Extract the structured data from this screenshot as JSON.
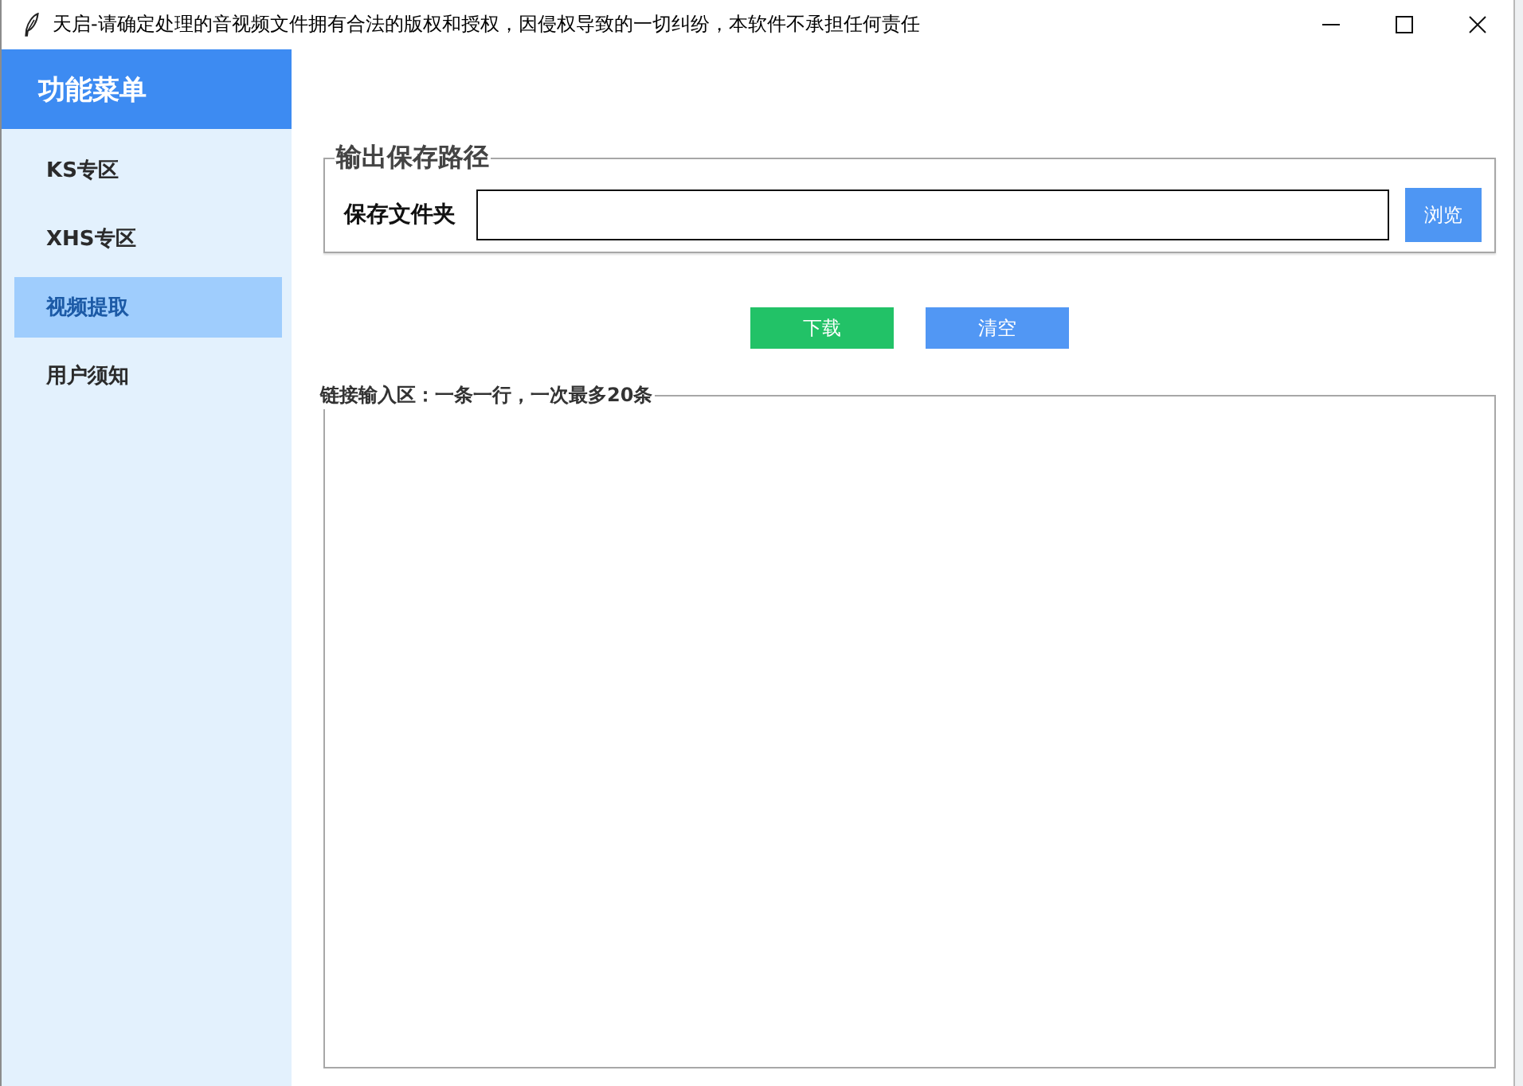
{
  "window": {
    "title": "天启-请确定处理的音视频文件拥有合法的版权和授权，因侵权导致的一切纠纷，本软件不承担任何责任"
  },
  "sidebar": {
    "header": "功能菜单",
    "items": [
      {
        "label": "KS专区",
        "selected": false
      },
      {
        "label": "XHS专区",
        "selected": false
      },
      {
        "label": "视频提取",
        "selected": true
      },
      {
        "label": "用户须知",
        "selected": false
      }
    ]
  },
  "output_path": {
    "legend": "输出保存路径",
    "label": "保存文件夹",
    "browse_button": "浏览"
  },
  "actions": [
    {
      "label": "下载",
      "kind": "download"
    },
    {
      "label": "清空",
      "kind": "clear"
    }
  ],
  "link_input": {
    "legend": "链接输入区：一条一行，一次最多20条"
  }
}
